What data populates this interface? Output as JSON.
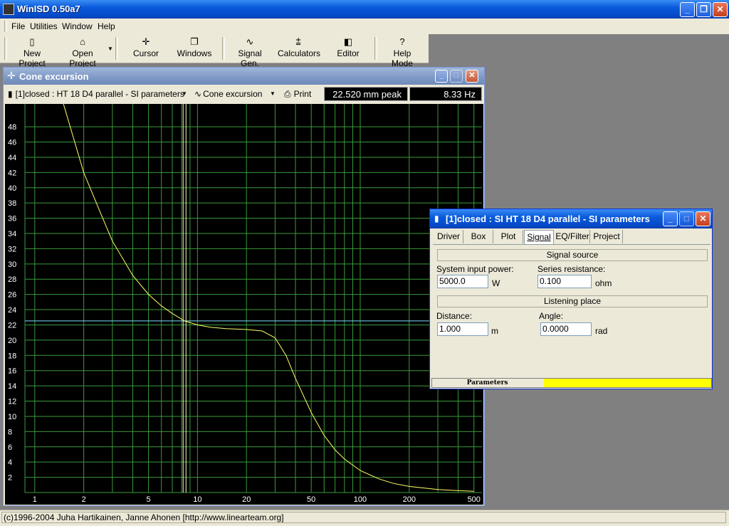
{
  "app": {
    "title": "WinISD 0.50a7"
  },
  "menu": [
    "File",
    "Utilities",
    "Window",
    "Help"
  ],
  "toolbar": {
    "new_project": "New Project",
    "open_project": "Open Project",
    "cursor": "Cursor",
    "windows": "Windows",
    "signal_gen": "Signal Gen.",
    "calculators": "Calculators",
    "editor": "Editor",
    "help_mode": "Help Mode"
  },
  "plot_window": {
    "title": "Cone excursion",
    "project_combo": "[1]closed : HT 18 D4 parallel - SI parameters",
    "graph_combo": "Cone excursion",
    "print": "Print",
    "readout_value": "22.520 mm peak",
    "readout_freq": "8.33 Hz"
  },
  "chart_data": {
    "type": "line",
    "title": "",
    "xlabel": "",
    "ylabel": "",
    "xscale": "log",
    "xlim": [
      0.87,
      560
    ],
    "ylim": [
      0,
      51
    ],
    "grid": true,
    "x_ticks": [
      1,
      2,
      5,
      10,
      20,
      50,
      100,
      200,
      500
    ],
    "y_ticks": [
      2,
      4,
      6,
      8,
      10,
      12,
      14,
      16,
      18,
      20,
      22,
      24,
      26,
      28,
      30,
      32,
      34,
      36,
      38,
      40,
      42,
      44,
      46,
      48
    ],
    "cursor": {
      "x": 8.33,
      "y": 22.52
    },
    "series": [
      {
        "x": [
          1.5,
          2,
          2.5,
          3,
          4,
          5,
          6,
          7,
          8.33,
          10,
          12,
          15,
          20,
          25,
          30,
          35,
          40,
          50,
          60,
          70,
          80,
          100,
          130,
          160,
          200,
          300,
          400,
          500
        ],
        "y": [
          51,
          42,
          37,
          33,
          28.5,
          26,
          24.5,
          23.5,
          22.52,
          22,
          21.7,
          21.5,
          21.4,
          21.2,
          20.3,
          18,
          15,
          10.5,
          7.5,
          5.6,
          4.4,
          2.9,
          1.8,
          1.2,
          0.8,
          0.4,
          0.25,
          0.17
        ]
      }
    ],
    "colors": {
      "curve": "#ffff66",
      "grid": "#3a9a3a",
      "cursor_v": "#ffffc0",
      "cursor_h": "#80e0ff",
      "bg": "#000000"
    }
  },
  "signal_dialog": {
    "title": "[1]closed : SI HT 18 D4 parallel - SI parameters",
    "tabs": [
      "Driver",
      "Box",
      "Plot",
      "Signal",
      "EQ/Filter",
      "Project"
    ],
    "active_tab": "Signal",
    "section_signal_source": "Signal source",
    "system_input_power_label": "System input power:",
    "system_input_power_value": "5000.0",
    "system_input_power_unit": "W",
    "series_resistance_label": "Series resistance:",
    "series_resistance_value": "0.100",
    "series_resistance_unit": "ohm",
    "section_listening_place": "Listening place",
    "distance_label": "Distance:",
    "distance_value": "1.000",
    "distance_unit": "m",
    "angle_label": "Angle:",
    "angle_value": "0.0000",
    "angle_unit": "rad",
    "status_label": "Parameters"
  },
  "statusbar": {
    "text": "(c)1996-2004 Juha Hartikainen, Janne Ahonen [http://www.linearteam.org]"
  }
}
